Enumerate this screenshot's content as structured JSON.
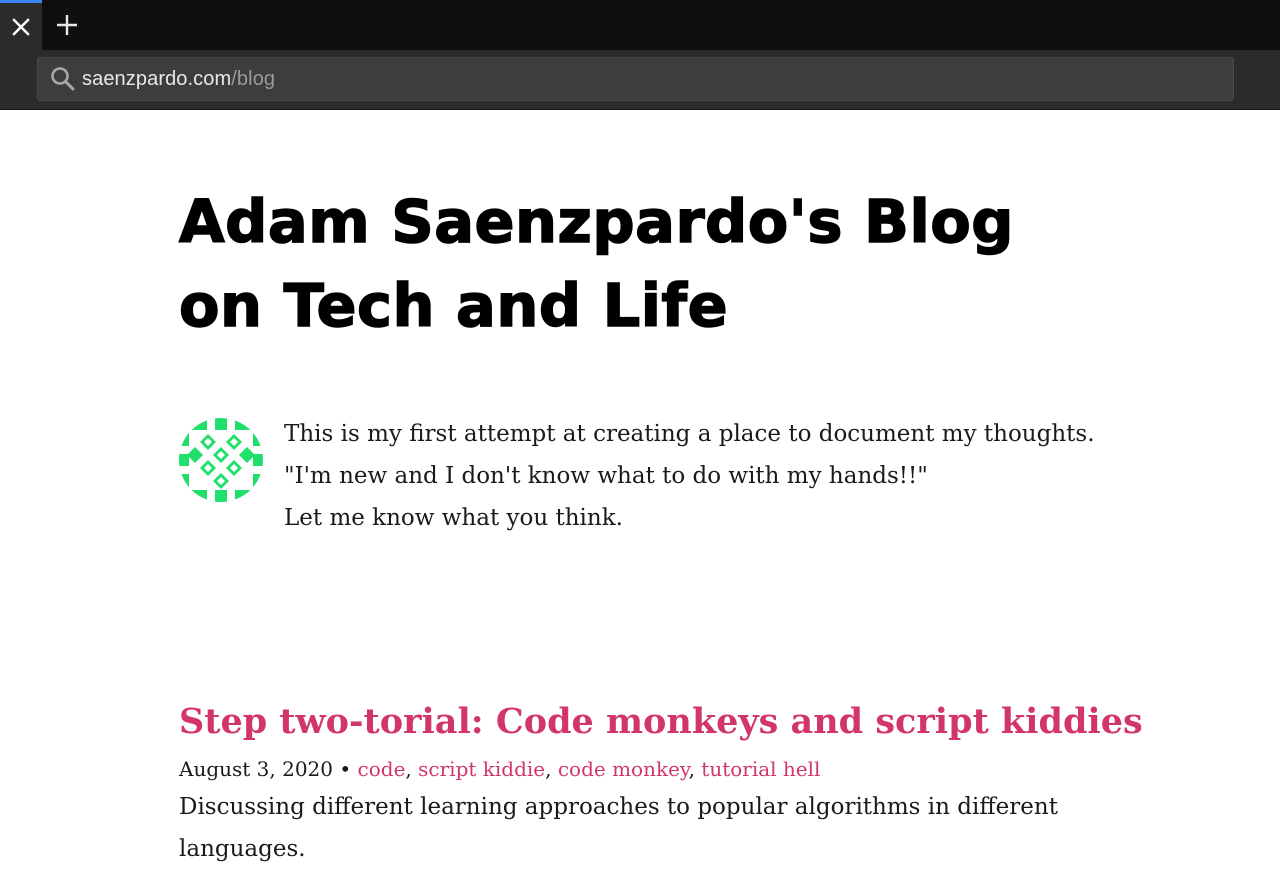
{
  "browser": {
    "tab_close_icon": "close-icon",
    "new_tab_icon": "plus-icon",
    "address": {
      "domain": "saenzpardo.com",
      "path": "/blog",
      "icon": "search-icon"
    },
    "accent_color": "#3b86f7"
  },
  "blog": {
    "title": "Adam Saenzpardo's Blog on Tech and Life",
    "avatar_icon": "identicon-avatar",
    "avatar_color": "#1fe06b",
    "intro_lines": [
      "This is my first attempt at creating a place to document my thoughts.",
      "\"I'm new and I don't know what to do with my hands!!\"",
      "Let me know what you think."
    ]
  },
  "posts": [
    {
      "title": "Step two-torial: Code monkeys and script kiddies",
      "date": "August 3, 2020",
      "separator": " • ",
      "tags": [
        "code",
        "script kiddie",
        "code monkey",
        "tutorial hell"
      ],
      "description": "Discussing different learning approaches to popular algorithms in different languages.",
      "accent_color": "#d23669"
    }
  ]
}
